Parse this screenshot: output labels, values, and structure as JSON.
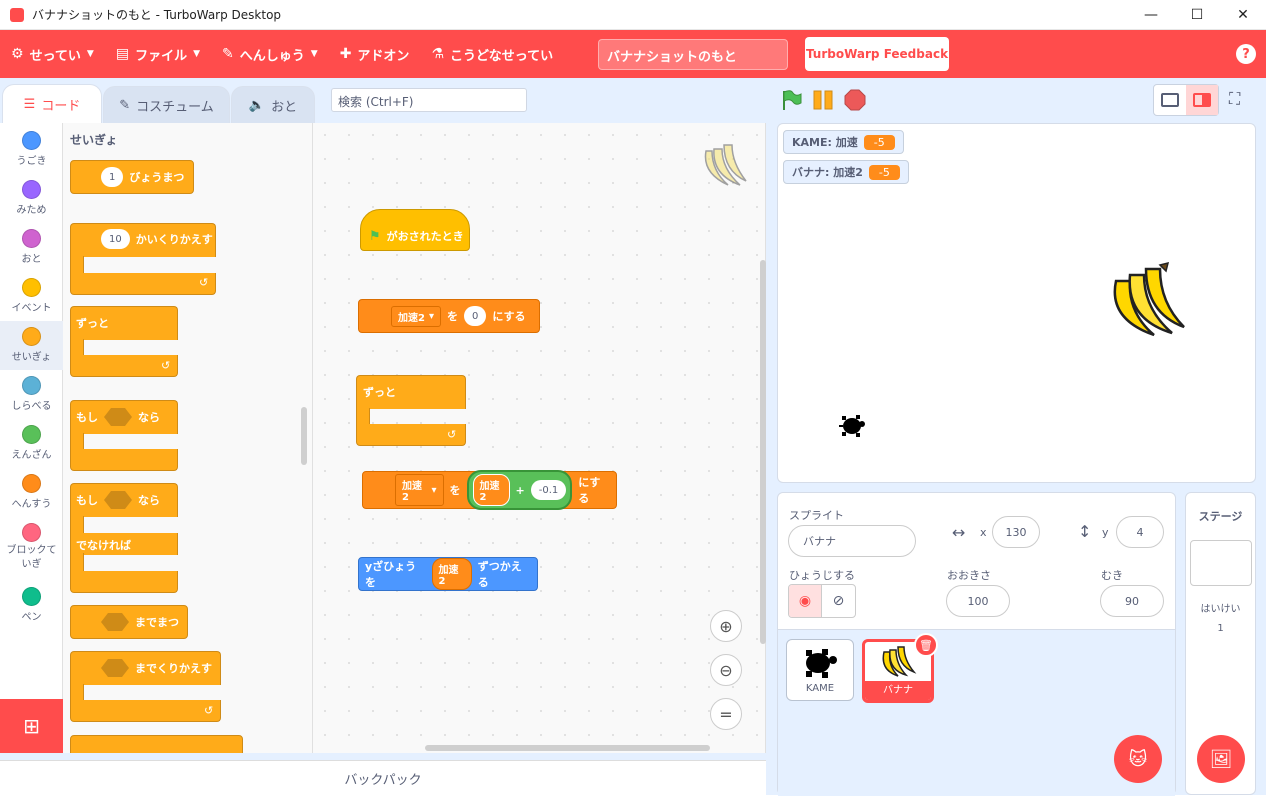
{
  "window": {
    "title": "バナナショットのもと - TurboWarp Desktop",
    "minimize": "—",
    "maximize": "☐",
    "close": "✕"
  },
  "menu": {
    "settings": "せってい",
    "file": "ファイル",
    "edit": "へんしゅう",
    "addons": "アドオン",
    "advanced": "こうどなせってい",
    "project_title": "バナナショットのもと",
    "feedback": "TurboWarp Feedback",
    "help": "?"
  },
  "tabs": {
    "code": "コード",
    "costumes": "コスチューム",
    "sounds": "おと"
  },
  "search": {
    "placeholder": "検索 (Ctrl+F)"
  },
  "categories": [
    {
      "label": "うごき",
      "color": "#4c97ff"
    },
    {
      "label": "みため",
      "color": "#9966ff"
    },
    {
      "label": "おと",
      "color": "#cf63cf"
    },
    {
      "label": "イベント",
      "color": "#ffbf00"
    },
    {
      "label": "せいぎょ",
      "color": "#ffab19"
    },
    {
      "label": "しらべる",
      "color": "#5cb1d6"
    },
    {
      "label": "えんざん",
      "color": "#59c059"
    },
    {
      "label": "へんすう",
      "color": "#ff8c1a"
    },
    {
      "label": "ブロックていぎ",
      "color": "#ff6680"
    },
    {
      "label": "ペン",
      "color": "#0fbd8c"
    }
  ],
  "palette": {
    "heading": "せいぎょ",
    "wait_value": "1",
    "wait_label": "びょうまつ",
    "repeat_value": "10",
    "repeat_label": "かいくりかえす",
    "forever": "ずっと",
    "if": "もし",
    "then": "なら",
    "else": "でなければ",
    "wait_until": "までまつ",
    "repeat_until": "までくりかえす"
  },
  "script": {
    "hat": "がおされたとき",
    "set_var": "加速2",
    "set_to": "を",
    "set_value": "0",
    "set_end": "にする",
    "forever": "ずっと",
    "set2_var": "加速2",
    "set2_to": "を",
    "op_left": "加速2",
    "op": "+",
    "op_right": "-0.1",
    "set2_end": "にする",
    "change_y": "yざひょうを",
    "change_var": "加速2",
    "change_end": "ずつかえる"
  },
  "backpack": "バックパック",
  "monitors": [
    {
      "label": "KAME: 加速",
      "value": "-5"
    },
    {
      "label": "バナナ: 加速2",
      "value": "-5"
    }
  ],
  "sprite_info": {
    "sprite_label": "スプライト",
    "sprite_name": "バナナ",
    "x_label": "x",
    "x": "130",
    "y_label": "y",
    "y": "4",
    "show_label": "ひょうじする",
    "size_label": "おおきさ",
    "size": "100",
    "direction_label": "むき",
    "direction": "90"
  },
  "sprites": [
    {
      "name": "KAME"
    },
    {
      "name": "バナナ"
    }
  ],
  "stage_panel": {
    "title": "ステージ",
    "backdrops_label": "はいけい",
    "backdrops_count": "1"
  }
}
